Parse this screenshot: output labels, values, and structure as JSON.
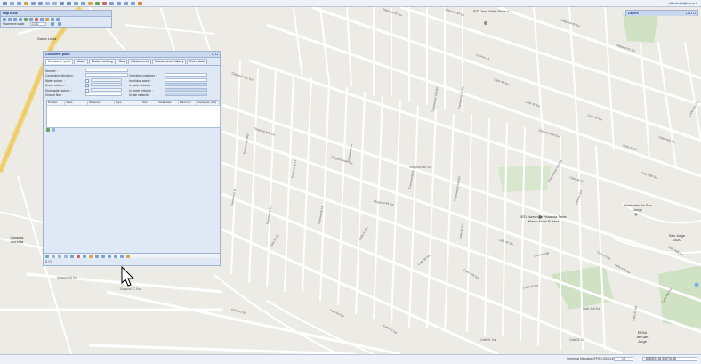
{
  "app": {
    "user_label": "ellisakdpt@nova.it"
  },
  "map_tools": {
    "title": "Map tools",
    "placement_scale_label": "Placement scale:",
    "placement_scale_value": "1:0.0"
  },
  "layers": {
    "title": "Layers"
  },
  "consumer_point": {
    "title": "Consumer point",
    "tabs": [
      "Consumer point",
      "Water",
      "District heating",
      "Gas",
      "Attachments",
      "Maintenance history",
      "Extra data"
    ],
    "fields": {
      "number": "Number :",
      "connection_elevation": "Connection elevation :",
      "water_subscr": "Water subscr. :",
      "sewer_subscr": "Sewer subscr. :",
      "stormwater_subscr": "Stormwater subscr. :",
      "ground_floor": "Ground floor :",
      "operation_customer": "Operation customer :",
      "individual_waste": "Individual waste :",
      "in_water_network": "In water network :",
      "in_sewer_network": "In sewer network :",
      "in_rain_network": "In rain network :"
    },
    "grid_columns": [
      "Number",
      "Class",
      "Measurer",
      "Type",
      "Size",
      "Install date",
      "Maximum",
      "Yearly use (m3)"
    ],
    "record_counter": "0 / 0"
  },
  "map_labels": {
    "ied_jose_marti": "IED José Martí Sede C",
    "ied_nuevo": "IED Nuevo de Holanda Sede Marco Fidel Suárez",
    "alamedas": "Alamedas de San Jorge",
    "san_jorge": "San Jorge 2020",
    "caracas": "Caracas Avenida",
    "santa_lucia": "Santa Lucía",
    "sol_san_jorge": "El Sol de San Jorge",
    "streets": [
      "Diagonal 49C Sur",
      "Diagonal 49B Sur",
      "Diagonal 48C Sur",
      "Diagonal 48D Sur",
      "Diagonal 48 Sur",
      "Diagonal 47 Sur",
      "Diagonal 46 Sur",
      "Diagonal 45A Sur",
      "Diagonal 44 Sur",
      "Diagonal 43 Sur",
      "Diagonal 42 Sur",
      "Diagonal 41 Sur",
      "Transversal 13",
      "Transversal 14",
      "Transversal 15",
      "Transversal 16",
      "Transversal 16D",
      "Transversal 17",
      "Transversal 18",
      "Transversal 14A Bis",
      "Transversal 13A Bis",
      "Transversal 12 Bis",
      "Transversal 11A Bis",
      "Carrera 11A",
      "Carrera 12B",
      "Carrera 13A",
      "Carrera 14",
      "Calle 44 Sur",
      "Calle 45 Sur",
      "Calle 46 Sur",
      "Calle 47 Sur",
      "Calle 48 Sur",
      "Calle 49 Sur",
      "Calle 50 Sur",
      "Calle 51 Sur",
      "Calle 52 Sur",
      "Calle 53 Sur",
      "Calle 54 Sur",
      "Calle 55 Sur",
      "Calle 56 Sur",
      "Calle 57 Sur",
      "Calle 58 Sur",
      "Calle 59 Sur",
      "Calle 60 Sur",
      "Calle 48A Sur",
      "Calle 49A Sur",
      "Calle 47B Sur",
      "Calle 48B Sur",
      "Calle 47A Sur",
      "Calle 45D Sur",
      "Calle 46A Sur",
      "Calle 46B Sur"
    ]
  },
  "status": {
    "projection": "Spherical Mercator (EPSG:900913)",
    "zoom_value": "18",
    "coordinates": "-8250934.84 508741.58"
  }
}
